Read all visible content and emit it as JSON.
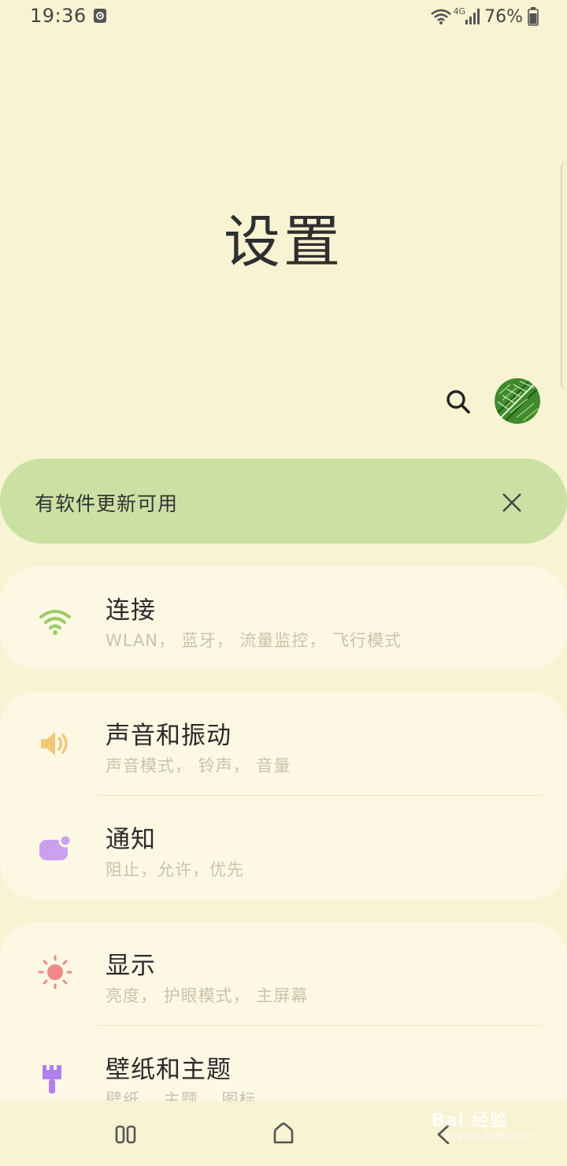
{
  "status": {
    "time": "19:36",
    "battery": "76%",
    "network": "4G"
  },
  "page": {
    "title": "设置"
  },
  "banner": {
    "text": "有软件更新可用"
  },
  "cards": [
    {
      "items": [
        {
          "title": "连接",
          "subtitle": "WLAN， 蓝牙， 流量监控， 飞行模式",
          "icon": "wifi-icon",
          "color": "#9ccc65"
        }
      ]
    },
    {
      "items": [
        {
          "title": "声音和振动",
          "subtitle": "声音模式， 铃声， 音量",
          "icon": "speaker-icon",
          "color": "#f2c77a"
        },
        {
          "title": "通知",
          "subtitle": "阻止，允许，优先",
          "icon": "notification-icon",
          "color": "#c9a1ee"
        }
      ]
    },
    {
      "items": [
        {
          "title": "显示",
          "subtitle": "亮度， 护眼模式， 主屏幕",
          "icon": "brightness-icon",
          "color": "#f08a88"
        },
        {
          "title": "壁纸和主题",
          "subtitle": "壁纸， 主题， 图标",
          "icon": "brush-icon",
          "color": "#b07ff0"
        }
      ]
    }
  ],
  "watermark": {
    "brand": "Bai 经验",
    "url": "jingyan.baidu.com"
  }
}
